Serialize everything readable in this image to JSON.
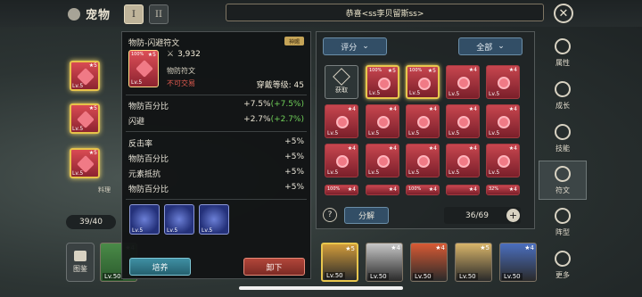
{
  "header": {
    "title": "宠物",
    "tab1": "I",
    "tab2": "II",
    "tagline": "恭喜<ss李贝留斯ss>",
    "close_icon": "close-icon"
  },
  "left": {
    "slots": [
      {
        "level": "Lv.5",
        "stars": "★5"
      },
      {
        "level": "Lv.5",
        "stars": "★5"
      },
      {
        "level": "Lv.5",
        "stars": "★5"
      }
    ],
    "food_label": "料理",
    "count": "39/40",
    "album_label": "图鉴"
  },
  "tooltip": {
    "name": "物防-闪避符文",
    "rarity": "神赐",
    "rune": {
      "pct": "100%",
      "stars": "★5",
      "level": "Lv.5"
    },
    "power": "3,932",
    "type": "物防符文",
    "trade": "不可交易",
    "req_level": "穿戴等级: 45",
    "main_stats": [
      {
        "name": "物防百分比",
        "plus": "+7.5%",
        "bonus": "(+7.5%)"
      },
      {
        "name": "闪避",
        "plus": "+2.7%",
        "bonus": "(+2.7%)"
      }
    ],
    "sub_stats": [
      {
        "name": "反击率",
        "value": "+5%"
      },
      {
        "name": "物防百分比",
        "value": "+5%"
      },
      {
        "name": "元素抵抗",
        "value": "+5%"
      },
      {
        "name": "物防百分比",
        "value": "+5%"
      }
    ],
    "set_icons": [
      {
        "level": "Lv.5"
      },
      {
        "level": "Lv.5"
      },
      {
        "level": "Lv.5"
      }
    ],
    "btn_nurture": "培养",
    "btn_unload": "卸下"
  },
  "inventory": {
    "sort_label": "评分",
    "filter_label": "全部",
    "acquire_label": "获取",
    "decompose_label": "分解",
    "capacity": "36/69",
    "help": "?",
    "plus": "+",
    "items": [
      {
        "pct": "100%",
        "stars": "★5",
        "level": "Lv.5",
        "gold": true
      },
      {
        "pct": "100%",
        "stars": "★5",
        "level": "Lv.5",
        "gold": true
      },
      {
        "pct": "",
        "stars": "★4",
        "level": "Lv.5",
        "gold": false
      },
      {
        "pct": "",
        "stars": "★4",
        "level": "Lv.5",
        "gold": false
      },
      {
        "pct": "",
        "stars": "★4",
        "level": "Lv.5",
        "gold": false
      },
      {
        "pct": "",
        "stars": "★4",
        "level": "Lv.5",
        "gold": false
      },
      {
        "pct": "",
        "stars": "★4",
        "level": "Lv.5",
        "gold": false
      },
      {
        "pct": "",
        "stars": "★4",
        "level": "Lv.5",
        "gold": false
      },
      {
        "pct": "",
        "stars": "★4",
        "level": "Lv.5",
        "gold": false
      },
      {
        "pct": "",
        "stars": "★4",
        "level": "Lv.5",
        "gold": false
      },
      {
        "pct": "",
        "stars": "★4",
        "level": "Lv.5",
        "gold": false
      },
      {
        "pct": "",
        "stars": "★4",
        "level": "Lv.5",
        "gold": false
      },
      {
        "pct": "",
        "stars": "★4",
        "level": "Lv.5",
        "gold": false
      },
      {
        "pct": "",
        "stars": "★4",
        "level": "Lv.5",
        "gold": false
      },
      {
        "pct": "",
        "stars": "★4",
        "level": "Lv.5",
        "gold": false
      }
    ],
    "partial_row": [
      {
        "pct": "100%",
        "stars": "★4"
      },
      {
        "pct": "",
        "stars": "★4"
      },
      {
        "pct": "100%",
        "stars": "★4"
      },
      {
        "pct": "",
        "stars": "★4"
      },
      {
        "pct": "32%",
        "stars": "★4"
      }
    ]
  },
  "sidebar": [
    {
      "label": "属性",
      "icon": "info-icon",
      "active": false
    },
    {
      "label": "成长",
      "icon": "growth-icon",
      "active": false
    },
    {
      "label": "技能",
      "icon": "skill-icon",
      "active": false
    },
    {
      "label": "符文",
      "icon": "rune-icon",
      "active": true
    },
    {
      "label": "阵型",
      "icon": "formation-icon",
      "active": false
    },
    {
      "label": "更多",
      "icon": "more-icon",
      "active": false
    }
  ],
  "pets": [
    {
      "level": "Lv.50",
      "stars": "★5",
      "color": "#d19b3b"
    },
    {
      "level": "Lv.50",
      "stars": "★4",
      "color": "#c7c7c7"
    },
    {
      "level": "Lv.50",
      "stars": "★4",
      "color": "#d85a34"
    },
    {
      "level": "Lv.50",
      "stars": "★5",
      "color": "#d9b56a"
    },
    {
      "level": "Lv.50",
      "stars": "★4",
      "color": "#4b6fbf"
    }
  ],
  "left_pets": [
    {
      "level": "Lv.50",
      "stars": "★4"
    }
  ]
}
